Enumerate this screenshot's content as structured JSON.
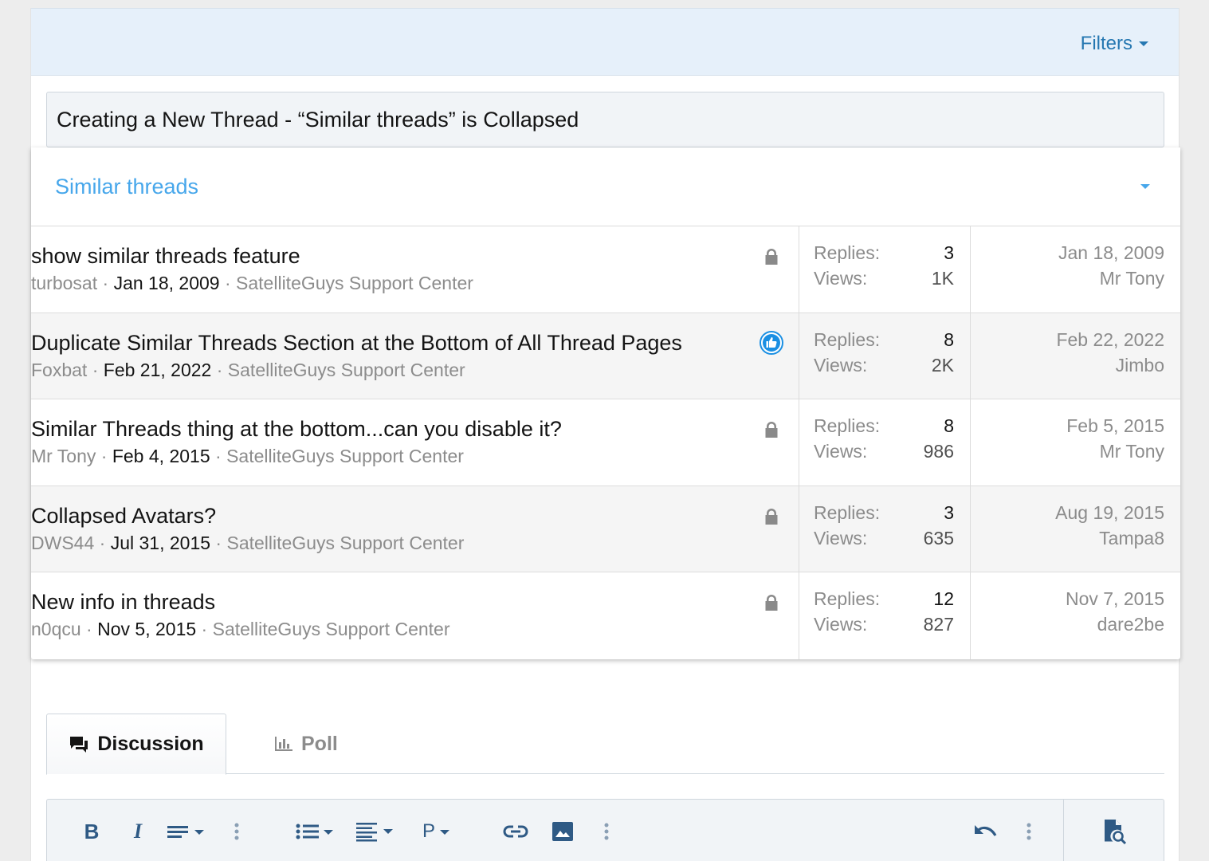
{
  "filters": {
    "label": "Filters"
  },
  "thread_title": {
    "value": "Creating a New Thread - “Similar threads” is Collapsed"
  },
  "similar": {
    "title": "Similar threads",
    "threads": [
      {
        "title": "show similar threads feature",
        "author": "turbosat",
        "sep1": " · ",
        "date": "Jan 18, 2009",
        "sep2": " · ",
        "forum": "SatelliteGuys Support Center",
        "status": "lock-icon",
        "replies_label": "Replies:",
        "replies": "3",
        "views_label": "Views:",
        "views": "1K",
        "last_date": "Jan 18, 2009",
        "last_user": "Mr Tony"
      },
      {
        "title": "Duplicate Similar Threads Section at the Bottom of All Thread Pages",
        "author": "Foxbat",
        "sep1": " · ",
        "date": "Feb 21, 2022",
        "sep2": " · ",
        "forum": "SatelliteGuys Support Center",
        "status": "thumbs-up-icon",
        "replies_label": "Replies:",
        "replies": "8",
        "views_label": "Views:",
        "views": "2K",
        "last_date": "Feb 22, 2022",
        "last_user": "Jimbo"
      },
      {
        "title": "Similar Threads thing at the bottom...can you disable it?",
        "author": "Mr Tony",
        "sep1": " · ",
        "date": "Feb 4, 2015",
        "sep2": " · ",
        "forum": "SatelliteGuys Support Center",
        "status": "lock-icon",
        "replies_label": "Replies:",
        "replies": "8",
        "views_label": "Views:",
        "views": "986",
        "last_date": "Feb 5, 2015",
        "last_user": "Mr Tony"
      },
      {
        "title": "Collapsed Avatars?",
        "author": "DWS44",
        "sep1": " · ",
        "date": "Jul 31, 2015",
        "sep2": " · ",
        "forum": "SatelliteGuys Support Center",
        "status": "lock-icon",
        "replies_label": "Replies:",
        "replies": "3",
        "views_label": "Views:",
        "views": "635",
        "last_date": "Aug 19, 2015",
        "last_user": "Tampa8"
      },
      {
        "title": "New info in threads",
        "author": "n0qcu",
        "sep1": " · ",
        "date": "Nov 5, 2015",
        "sep2": " · ",
        "forum": "SatelliteGuys Support Center",
        "status": "lock-icon",
        "replies_label": "Replies:",
        "replies": "12",
        "views_label": "Views:",
        "views": "827",
        "last_date": "Nov 7, 2015",
        "last_user": "dare2be"
      }
    ]
  },
  "tabs": [
    {
      "label": "Discussion",
      "icon": "comments-icon",
      "active": true
    },
    {
      "label": "Poll",
      "icon": "bar-chart-icon",
      "active": false
    }
  ],
  "toolbar": {
    "buttons": [
      "bold-icon",
      "italic-icon",
      "text-options-icon",
      "more-vertical-icon",
      "list-icon",
      "align-icon",
      "paragraph-format-icon",
      "link-icon",
      "image-icon",
      "more-vertical-icon",
      "undo-icon",
      "more-vertical-icon",
      "preview-icon"
    ],
    "bold_glyph": "B",
    "italic_glyph": "I",
    "paragraph_glyph": "P"
  },
  "colors": {
    "link": "#2577b1",
    "accent": "#47a7eb",
    "filter_bar_bg": "#e6f0fa",
    "muted_text": "#8c8c8c",
    "thumbs_badge": "#1a8fe3"
  }
}
